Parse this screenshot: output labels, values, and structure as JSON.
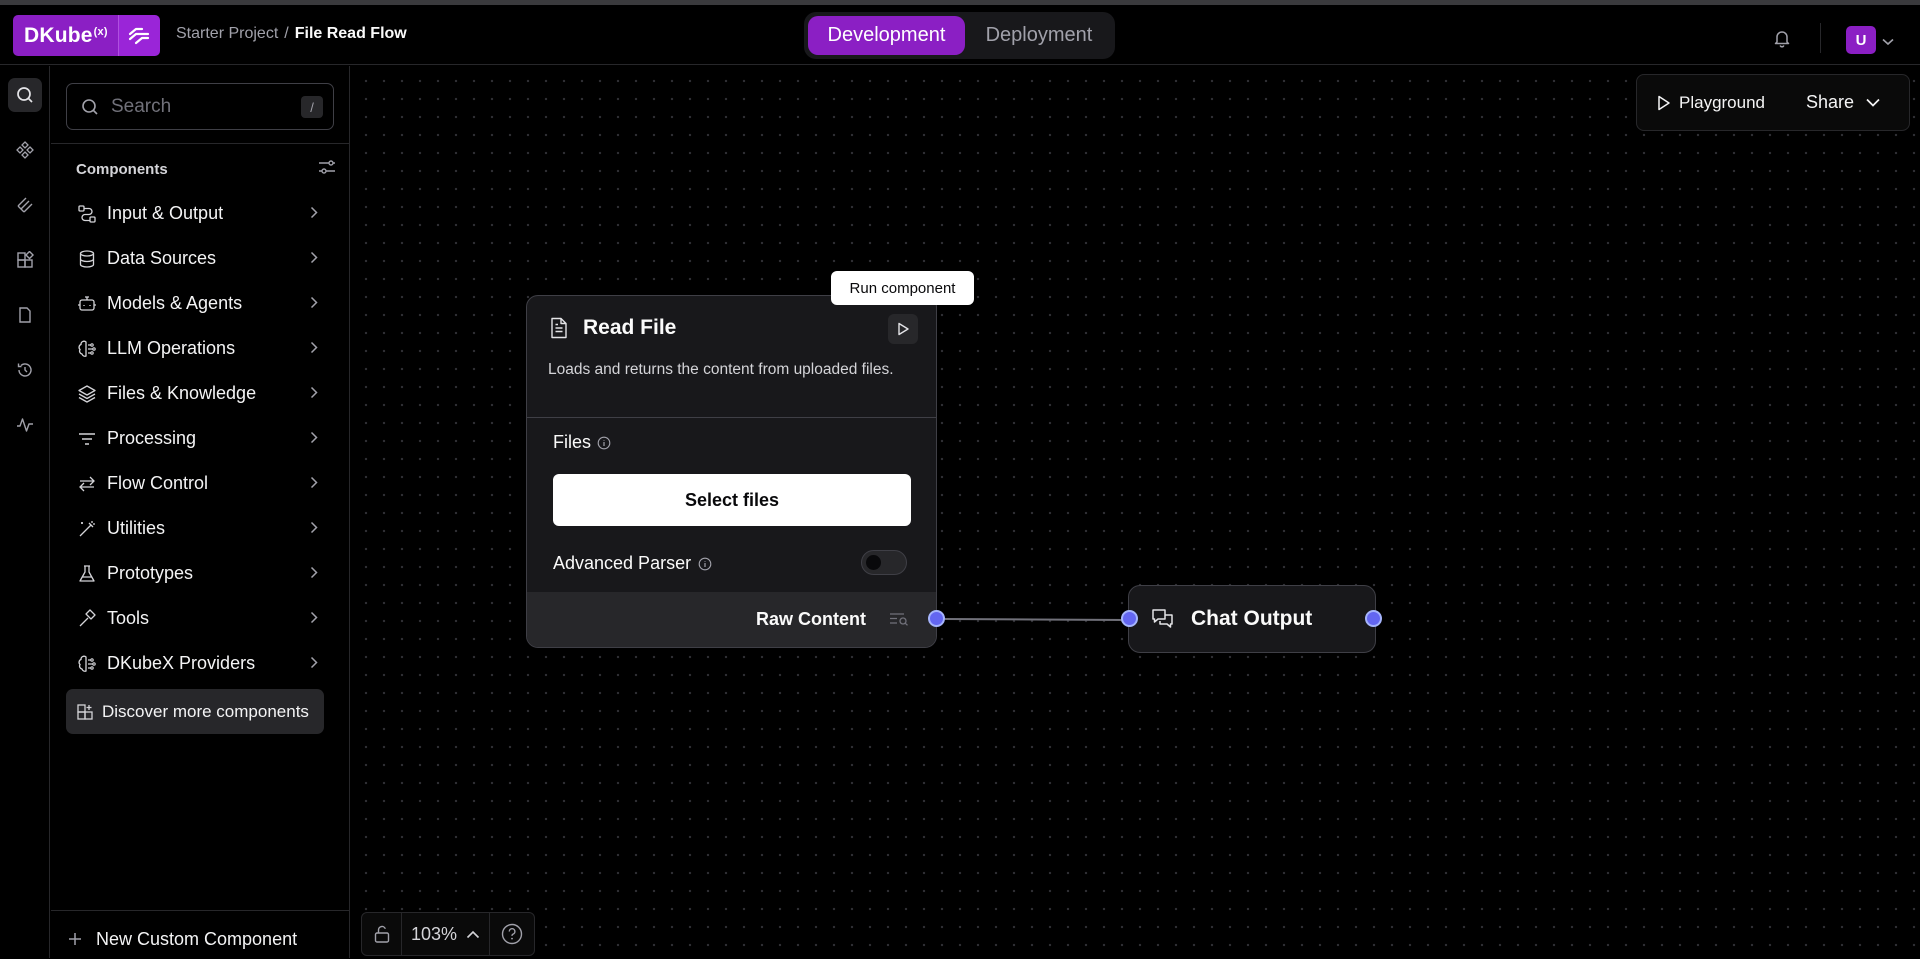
{
  "header": {
    "logo_text": "DKube",
    "logo_sup": "(x)",
    "breadcrumb_parent": "Starter Project",
    "breadcrumb_sep": "/",
    "breadcrumb_current": "File Read Flow",
    "mode_development": "Development",
    "mode_deployment": "Deployment",
    "avatar_initial": "U"
  },
  "sidebar": {
    "search_placeholder": "Search",
    "search_shortcut": "/",
    "components_title": "Components",
    "categories": [
      {
        "label": "Input & Output",
        "icon": "input-output-icon"
      },
      {
        "label": "Data Sources",
        "icon": "database-icon"
      },
      {
        "label": "Models & Agents",
        "icon": "bot-icon"
      },
      {
        "label": "LLM Operations",
        "icon": "brain-icon"
      },
      {
        "label": "Files & Knowledge",
        "icon": "layers-icon"
      },
      {
        "label": "Processing",
        "icon": "filter-lines-icon"
      },
      {
        "label": "Flow Control",
        "icon": "arrows-icon"
      },
      {
        "label": "Utilities",
        "icon": "wand-icon"
      },
      {
        "label": "Prototypes",
        "icon": "flask-icon"
      },
      {
        "label": "Tools",
        "icon": "hammer-icon"
      },
      {
        "label": "DKubeX Providers",
        "icon": "brain-icon"
      }
    ],
    "discover_label": "Discover more components",
    "new_component_label": "New Custom Component"
  },
  "canvas": {
    "playground_label": "Playground",
    "share_label": "Share",
    "tooltip": "Run component",
    "read_file": {
      "title": "Read File",
      "description": "Loads and returns the content from uploaded files.",
      "files_label": "Files",
      "select_files": "Select files",
      "advanced_parser": "Advanced Parser",
      "advanced_parser_enabled": false,
      "output_label": "Raw Content"
    },
    "chat_output": {
      "title": "Chat Output"
    },
    "zoom_level": "103%"
  },
  "colors": {
    "accent": "#8b1fc4",
    "handle": "#6366f1"
  }
}
